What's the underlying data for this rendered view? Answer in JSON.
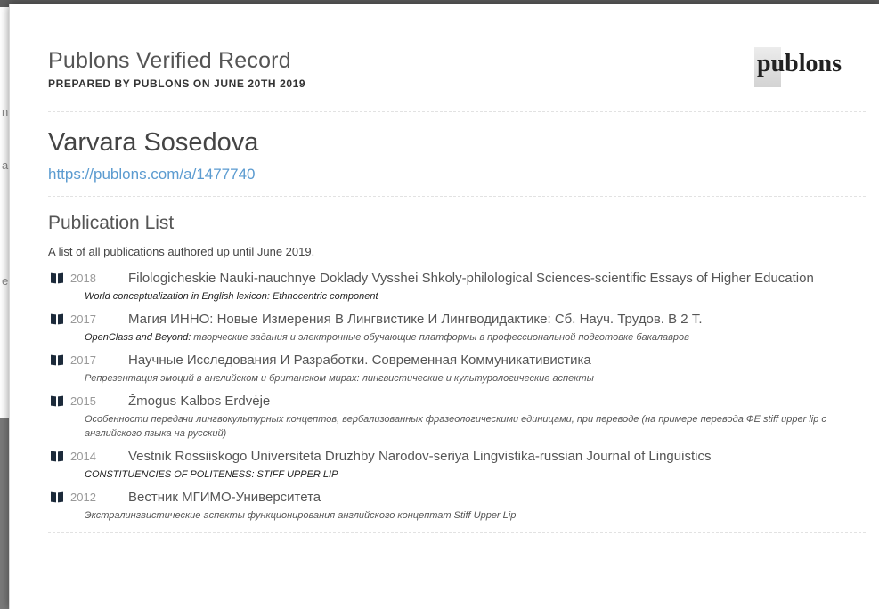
{
  "record": {
    "title": "Publons Verified Record",
    "subtitle": "PREPARED BY PUBLONS ON JUNE 20TH 2019",
    "logo_text": "publons"
  },
  "person": {
    "name": "Varvara Sosedova",
    "url": "https://publons.com/a/1477740"
  },
  "publications": {
    "title": "Publication List",
    "description": "A list of all publications authored up until June 2019.",
    "items": [
      {
        "year": "2018",
        "journal": "Filologicheskie Nauki-nauchnye Doklady Vysshei Shkoly-philological Sciences-scientific Essays of Higher Education",
        "article_pre": "World conceptualization in English lexicon: Ethnocentric component",
        "article_bold": "",
        "article_post": ""
      },
      {
        "year": "2017",
        "journal": "Магия ИННО: Новые Измерения В Лингвистике И Лингводидактике: Сб. Науч. Трудов. В 2 Т.",
        "article_pre": "OpenClass and Beyond:",
        "article_bold": "",
        "article_post": " творческие задания и электронные обучающие платформы в профессиональной подготовке бакалавров"
      },
      {
        "year": "2017",
        "journal": "Научные Исследования И Разработки. Современная Коммуникативистика",
        "article_pre": "",
        "article_bold": "",
        "article_post": "Репрезентация эмоций в английском и британском мирах: лингвистические и культурологические аспекты"
      },
      {
        "year": "2015",
        "journal": "Žmogus Kalbos Erdvėje",
        "article_pre": "",
        "article_bold": "",
        "article_post": "Особенности передачи лингвокультурных концептов, вербализованных фразеологическими единицами, при переводе (на примере перевода ФЕ stiff upper lip с английского языка на русский)"
      },
      {
        "year": "2014",
        "journal": "Vestnik Rossiiskogo Universiteta Druzhby Narodov-seriya Lingvistika-russian Journal of Linguistics",
        "article_pre": "CONSTITUENCIES OF POLITENESS: STIFF UPPER LIP",
        "article_bold": "",
        "article_post": ""
      },
      {
        "year": "2012",
        "journal": "Вестник МГИМО-Университета",
        "article_pre": "",
        "article_bold": "",
        "article_post": "Экстралингвистические аспекты функционирования английского концептат Stiff Upper Lip"
      }
    ]
  }
}
